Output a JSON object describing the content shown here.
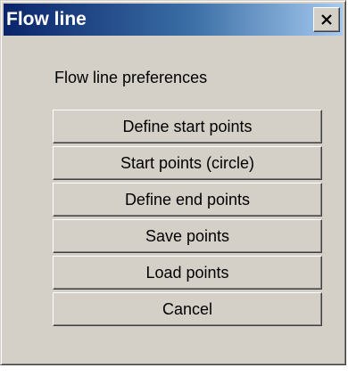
{
  "window": {
    "title": "Flow line",
    "close_icon": "close-icon"
  },
  "content": {
    "section_label": "Flow line preferences"
  },
  "buttons": [
    {
      "label": "Define start points"
    },
    {
      "label": "Start points (circle)"
    },
    {
      "label": "Define end points"
    },
    {
      "label": "Save points"
    },
    {
      "label": "Load points"
    },
    {
      "label": "Cancel"
    }
  ],
  "colors": {
    "titlebar_start": "#0a246a",
    "titlebar_end": "#a6caf0",
    "face": "#d4d0c8"
  }
}
